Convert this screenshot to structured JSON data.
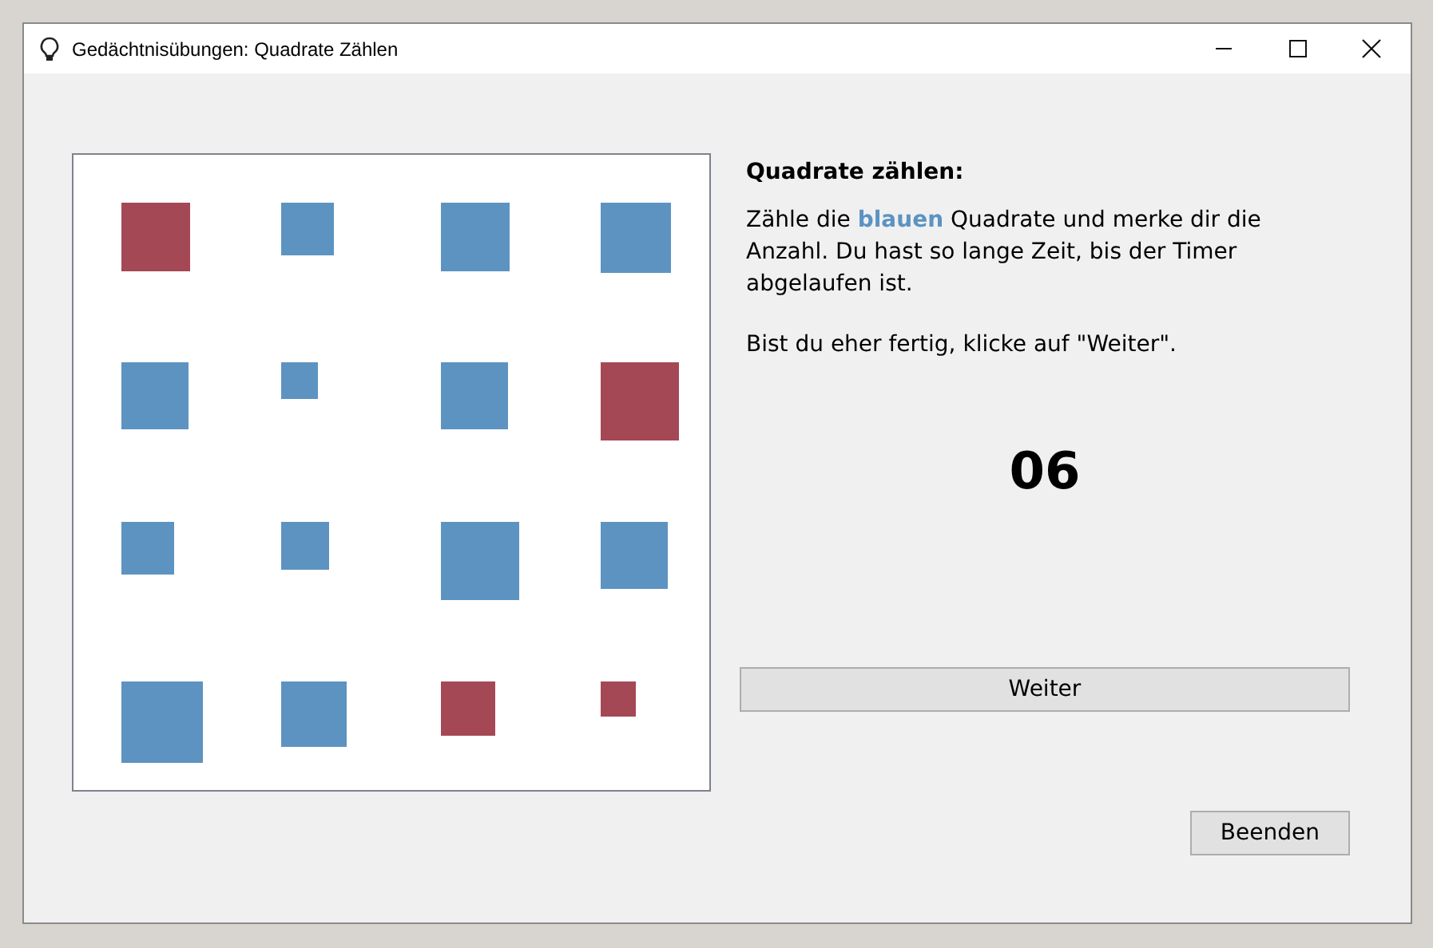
{
  "window": {
    "title": "Gedächtnisübungen: Quadrate Zählen"
  },
  "board": {
    "squares": [
      {
        "color": "#a54856"
      },
      {
        "color": "#5d93c1"
      },
      {
        "color": "#5d93c1"
      },
      {
        "color": "#5d93c1"
      },
      {
        "color": "#5d93c1"
      },
      {
        "color": "#5d93c1"
      },
      {
        "color": "#5d93c1"
      },
      {
        "color": "#a54856"
      },
      {
        "color": "#5d93c1"
      },
      {
        "color": "#5d93c1"
      },
      {
        "color": "#5d93c1"
      },
      {
        "color": "#5d93c1"
      },
      {
        "color": "#5d93c1"
      },
      {
        "color": "#5d93c1"
      },
      {
        "color": "#a54856"
      },
      {
        "color": "#a54856"
      }
    ]
  },
  "instructions": {
    "heading": "Quadrate zählen:",
    "paragraphs": [
      "Zähle die **blauen** Quadrate und merke dir die Anzahl. Du hast so lange Zeit, bis der Timer abgelaufen ist.",
      "Bist du eher fertig, klicke auf \"Weiter\"."
    ]
  },
  "timer": "06",
  "next_button": "Weiter",
  "quit_button": "Beenden"
}
